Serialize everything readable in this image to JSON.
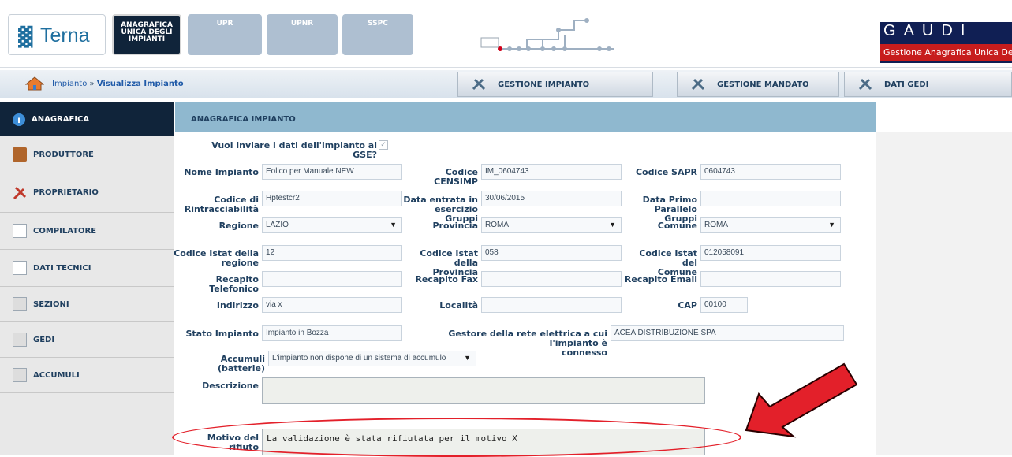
{
  "header": {
    "logo": "Terna",
    "nav": [
      {
        "label": "ANAGRAFICA\nUNICA DEGLI\nIMPIANTI",
        "active": true
      },
      {
        "label": "UPR"
      },
      {
        "label": "UPNR"
      },
      {
        "label": "SSPC"
      }
    ],
    "gaudi_letters": [
      "G",
      "A",
      "U",
      "D",
      "I"
    ],
    "gaudi_subtitle": "Gestione Anagrafica Unica Degli Impianti",
    "brand_colors": {
      "navy": "#10243a",
      "red": "#c71d1d",
      "panel": "#8fb8cf"
    }
  },
  "breadcrumb": {
    "root": "Impianto",
    "sep": "»",
    "current": "Visualizza Impianto"
  },
  "actions": [
    "GESTIONE IMPIANTO",
    "GESTIONE MANDATO",
    "DATI GEDI"
  ],
  "sidebar": {
    "items": [
      {
        "label": "ANAGRAFICA",
        "icon": "info-icon",
        "active": true
      },
      {
        "label": "PRODUTTORE",
        "icon": "briefcase-icon"
      },
      {
        "label": "PROPRIETARIO",
        "icon": "tools-icon"
      },
      {
        "label": "COMPILATORE",
        "icon": "document-icon"
      },
      {
        "label": "DATI TECNICI",
        "icon": "document-icon"
      },
      {
        "label": "SEZIONI",
        "icon": "stack-icon"
      },
      {
        "label": "GEDI",
        "icon": "stack-icon"
      },
      {
        "label": "ACCUMULI",
        "icon": "stack-icon"
      }
    ]
  },
  "panel": {
    "title": "ANAGRAFICA IMPIANTO",
    "question": "Vuoi inviare i dati dell'impianto al GSE?",
    "question_checked": true,
    "labels": {
      "nome_impianto": "Nome Impianto",
      "codice_censimp": "Codice CENSIMP",
      "codice_sapr": "Codice SAPR",
      "codice_rintracciabilita": "Codice di\nRintracciabilità",
      "data_entrata": "Data entrata in\nesercizio Gruppi",
      "data_primo": "Data Primo\nParallelo Gruppi",
      "regione": "Regione",
      "provincia": "Provincia",
      "comune": "Comune",
      "istat_regione": "Codice Istat della\nregione",
      "istat_provincia": "Codice Istat della\nProvincia",
      "istat_comune": "Codice Istat del\nComune",
      "recapito_tel": "Recapito\nTelefonico",
      "recapito_fax": "Recapito Fax",
      "recapito_email": "Recapito Email",
      "indirizzo": "Indirizzo",
      "localita": "Località",
      "cap": "CAP",
      "stato": "Stato Impianto",
      "gestore": "Gestore della rete elettrica a cui l'impianto è\nconnesso",
      "accumuli": "Accumuli (batterie)",
      "descrizione": "Descrizione",
      "motivo": "Motivo del rifiuto"
    },
    "values": {
      "nome_impianto": "Eolico per Manuale NEW",
      "codice_censimp": "IM_0604743",
      "codice_sapr": "0604743",
      "codice_rintracciabilita": "Hptestcr2",
      "data_entrata": "30/06/2015",
      "data_primo": "",
      "regione": "LAZIO",
      "provincia": "ROMA",
      "comune": "ROMA",
      "istat_regione": "12",
      "istat_provincia": "058",
      "istat_comune": "012058091",
      "recapito_tel": "",
      "recapito_fax": "",
      "recapito_email": "",
      "indirizzo": "via x",
      "localita": "",
      "cap": "00100",
      "stato": "Impianto in Bozza",
      "gestore": "ACEA DISTRIBUZIONE SPA",
      "accumuli": "L'impianto non dispone di un sistema di accumulo",
      "descrizione": "",
      "motivo": "La validazione è stata rifiutata per il motivo X"
    }
  }
}
